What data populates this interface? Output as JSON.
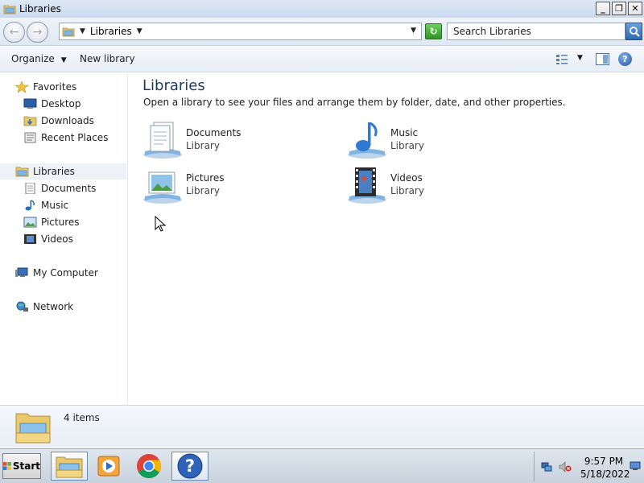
{
  "window": {
    "title": "Libraries",
    "controls": {
      "minimize": "_",
      "maximize": "❐",
      "close": "✕"
    }
  },
  "address": {
    "breadcrumb": "Libraries",
    "search_placeholder": "Search Libraries"
  },
  "toolbar": {
    "organize_label": "Organize",
    "new_library_label": "New library"
  },
  "sidebar": {
    "favorites": {
      "label": "Favorites",
      "items": [
        {
          "label": "Desktop",
          "icon": "desktop-icon"
        },
        {
          "label": "Downloads",
          "icon": "downloads-icon"
        },
        {
          "label": "Recent Places",
          "icon": "recent-places-icon"
        }
      ]
    },
    "libraries": {
      "label": "Libraries",
      "items": [
        {
          "label": "Documents",
          "icon": "documents-icon"
        },
        {
          "label": "Music",
          "icon": "music-icon"
        },
        {
          "label": "Pictures",
          "icon": "pictures-icon"
        },
        {
          "label": "Videos",
          "icon": "videos-icon"
        }
      ]
    },
    "computer": {
      "label": "My Computer"
    },
    "network": {
      "label": "Network"
    }
  },
  "main": {
    "heading": "Libraries",
    "description": "Open a library to see your files and arrange them by folder, date, and other properties.",
    "libraries": [
      {
        "name": "Documents",
        "type": "Library",
        "icon": "documents-library-icon"
      },
      {
        "name": "Music",
        "type": "Library",
        "icon": "music-library-icon"
      },
      {
        "name": "Pictures",
        "type": "Library",
        "icon": "pictures-library-icon"
      },
      {
        "name": "Videos",
        "type": "Library",
        "icon": "videos-library-icon"
      }
    ]
  },
  "details": {
    "item_count": "4 items"
  },
  "taskbar": {
    "start_label": "Start",
    "clock_time": "9:57 PM",
    "clock_date": "5/18/2022",
    "colors": {
      "chrome_red": "#db4437",
      "chrome_green": "#0f9d58",
      "chrome_yellow": "#f4b400",
      "chrome_blue": "#4285f4"
    }
  }
}
